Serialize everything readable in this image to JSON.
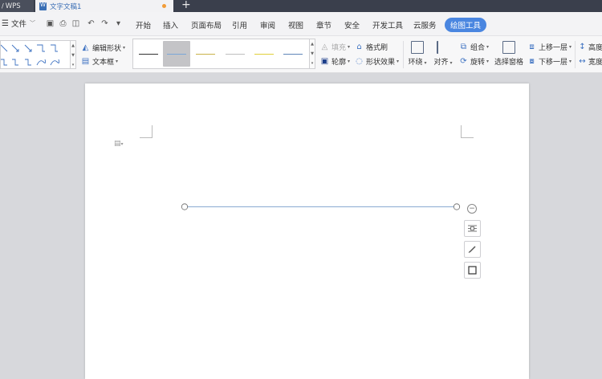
{
  "titlebar": {
    "app_tab": "WPS",
    "doc_tab": "文字文稿1"
  },
  "menubar": {
    "file_label": "文件",
    "items": [
      "开始",
      "插入",
      "页面布局",
      "引用",
      "审阅",
      "视图",
      "章节",
      "安全",
      "开发工具",
      "云服务",
      "绘图工具"
    ],
    "active_item": "绘图工具"
  },
  "ribbon": {
    "edit_shape": "编辑形状",
    "text_box": "文本框",
    "fill": "填充",
    "format_painter": "格式刷",
    "outline": "轮廓",
    "shape_effect": "形状效果",
    "wrap": "环绕",
    "align": "对齐",
    "group": "组合",
    "rotate": "旋转",
    "selection_pane": "选择窗格",
    "bring_forward": "上移一层",
    "send_backward": "下移一层",
    "height": "高度",
    "width": "宽度",
    "line_style_colors": [
      "#333333",
      "#7aa7d8",
      "#c9b24a",
      "#bfbfbf",
      "#e0cf3a",
      "#5f86b9"
    ],
    "selected_style_index": 1
  },
  "colors": {
    "accent": "#4a86e0",
    "titlebar": "#3a3f4c",
    "selected_line": "#9ab5d8",
    "unsaved_dot": "#f29c38"
  }
}
